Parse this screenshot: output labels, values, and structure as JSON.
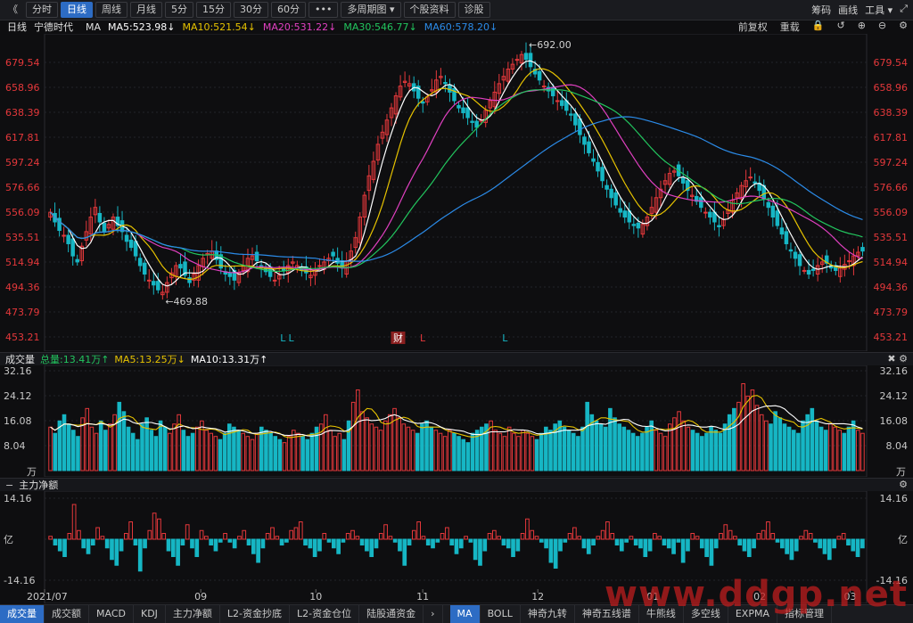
{
  "toolbar": {
    "back_icon": "double-chevron-left-icon",
    "periods": [
      "分时",
      "日线",
      "周线",
      "月线",
      "5分",
      "15分",
      "30分",
      "60分"
    ],
    "active_period": "日线",
    "more": "•••",
    "multi_period": "多周期图 ▾",
    "stock_info": "个股资料",
    "diagnose": "诊股",
    "right": [
      "筹码",
      "画线",
      "工具 ▾"
    ],
    "expand_icon": "expand-icon"
  },
  "legend": {
    "period": "日线",
    "stock_name": "宁德时代",
    "ma_label": "MA",
    "ma5": "MA5:523.98↓",
    "ma10": "MA10:521.54↓",
    "ma20": "MA20:531.22↓",
    "ma30": "MA30:546.77↓",
    "ma60": "MA60:578.20↓",
    "adjust": "前复权",
    "overlay": "重载"
  },
  "volume_head": {
    "title": "成交量",
    "total": "总量:13.41万↑",
    "ma5": "MA5:13.25万↓",
    "ma10": "MA10:13.31万↑"
  },
  "money_head": {
    "title": "主力净额"
  },
  "colors": {
    "up": "#e5383b",
    "down": "#16b6c4",
    "ma5": "#ffffff",
    "ma10": "#e6c200",
    "ma20": "#e040c0",
    "ma30": "#22c55e",
    "ma60": "#2b8be8"
  },
  "chart_data": [
    {
      "type": "candlestick",
      "title": "宁德时代 日线",
      "y_ticks": [
        "679.54",
        "658.96",
        "638.39",
        "617.81",
        "597.24",
        "576.66",
        "556.09",
        "535.51",
        "514.94",
        "494.36",
        "473.79",
        "453.21"
      ],
      "ylim": [
        453.21,
        679.54
      ],
      "x_ticks": [
        "2021/07",
        "09",
        "10",
        "11",
        "12",
        "01",
        "02",
        "03"
      ],
      "annotations": [
        {
          "label": "←692.00",
          "type": "high"
        },
        {
          "label": "←469.88",
          "type": "low"
        }
      ],
      "markers": [
        "L",
        "L",
        "财",
        "L",
        "L"
      ],
      "closes": [
        556,
        548,
        541,
        537,
        530,
        520,
        515,
        528,
        540,
        552,
        560,
        548,
        540,
        546,
        552,
        545,
        540,
        532,
        527,
        520,
        512,
        505,
        500,
        496,
        492,
        490,
        498,
        506,
        512,
        510,
        504,
        498,
        505,
        512,
        518,
        522,
        524,
        517,
        510,
        505,
        503,
        500,
        506,
        512,
        518,
        520,
        516,
        510,
        507,
        503,
        500,
        504,
        508,
        512,
        515,
        512,
        508,
        506,
        504,
        508,
        512,
        515,
        518,
        520,
        514,
        510,
        516,
        524,
        535,
        552,
        570,
        586,
        598,
        612,
        622,
        632,
        642,
        652,
        660,
        664,
        662,
        656,
        650,
        646,
        651,
        657,
        665,
        668,
        662,
        655,
        648,
        642,
        638,
        634,
        630,
        626,
        632,
        640,
        648,
        655,
        662,
        668,
        674,
        678,
        682,
        686,
        682,
        676,
        670,
        665,
        660,
        656,
        652,
        648,
        644,
        640,
        636,
        628,
        620,
        612,
        605,
        598,
        590,
        582,
        575,
        568,
        562,
        556,
        552,
        548,
        545,
        543,
        546,
        552,
        560,
        568,
        575,
        582,
        588,
        590,
        586,
        580,
        574,
        570,
        565,
        560,
        556,
        552,
        548,
        544,
        550,
        558,
        566,
        572,
        578,
        582,
        585,
        580,
        574,
        567,
        560,
        552,
        545,
        538,
        530,
        524,
        518,
        512,
        508,
        505,
        508,
        512,
        515,
        514,
        510,
        508,
        510,
        513,
        516,
        520,
        523,
        524
      ]
    },
    {
      "type": "bar",
      "title": "成交量",
      "unit": "万",
      "y_ticks": [
        "32.16",
        "24.12",
        "16.08",
        "8.04"
      ],
      "ylim": [
        0,
        32.16
      ],
      "values": [
        14,
        12,
        16,
        18,
        15,
        13,
        11,
        17,
        20,
        14,
        12,
        16,
        13,
        15,
        18,
        22,
        19,
        14,
        12,
        10,
        15,
        17,
        13,
        11,
        16,
        14,
        12,
        15,
        18,
        13,
        11,
        12,
        14,
        16,
        13,
        12,
        11,
        10,
        12,
        15,
        14,
        13,
        12,
        11,
        10,
        12,
        14,
        13,
        12,
        11,
        10,
        9,
        11,
        13,
        12,
        11,
        10,
        12,
        14,
        15,
        18,
        13,
        11,
        12,
        10,
        16,
        22,
        26,
        19,
        17,
        15,
        14,
        13,
        16,
        18,
        20,
        17,
        15,
        14,
        13,
        12,
        15,
        16,
        14,
        13,
        12,
        11,
        13,
        12,
        11,
        10,
        9,
        12,
        13,
        14,
        15,
        16,
        13,
        12,
        11,
        14,
        12,
        11,
        13,
        12,
        11,
        10,
        12,
        14,
        13,
        15,
        16,
        14,
        13,
        12,
        11,
        14,
        22,
        18,
        16,
        15,
        14,
        20,
        17,
        15,
        14,
        13,
        12,
        11,
        12,
        14,
        16,
        13,
        12,
        11,
        15,
        17,
        19,
        16,
        14,
        13,
        12,
        11,
        12,
        14,
        13,
        12,
        15,
        18,
        20,
        22,
        28,
        24,
        26,
        21,
        18,
        16,
        15,
        19,
        17,
        15,
        14,
        13,
        12,
        16,
        18,
        20,
        16,
        14,
        13,
        15,
        14,
        13,
        12,
        14,
        16,
        13,
        12
      ]
    },
    {
      "type": "bar",
      "title": "主力净额",
      "unit": "亿",
      "y_ticks": [
        "14.16",
        "亿",
        "-14.16"
      ],
      "ylim": [
        -14.16,
        14.16
      ],
      "values": [
        1,
        -2,
        -4,
        -6,
        2,
        12,
        3,
        -3,
        -5,
        -2,
        4,
        1,
        -3,
        -7,
        -9,
        -4,
        2,
        6,
        -2,
        -11,
        -3,
        3,
        9,
        7,
        2,
        -4,
        -6,
        -9,
        -2,
        5,
        -3,
        -6,
        3,
        1,
        -2,
        -4,
        -1,
        2,
        -1,
        -3,
        1,
        3,
        -2,
        -5,
        -8,
        -3,
        2,
        4,
        1,
        -2,
        -1,
        3,
        4,
        6,
        -2,
        -3,
        -6,
        -4,
        2,
        -1,
        -3,
        -5,
        -1,
        2,
        3,
        1,
        -2,
        -4,
        -6,
        -3,
        2,
        5,
        1,
        -1,
        -4,
        -9,
        -2,
        3,
        6,
        1,
        -2,
        -3,
        -1,
        2,
        4,
        -2,
        -5,
        -3,
        1,
        -1,
        -7,
        -9,
        -4,
        2,
        3,
        1,
        -2,
        -3,
        -6,
        -4,
        2,
        7,
        3,
        1,
        -1,
        -3,
        -8,
        -10,
        -4,
        -1,
        2,
        4,
        1,
        -3,
        -5,
        -2,
        1,
        3,
        6,
        2,
        -2,
        -4,
        -1,
        1,
        -2,
        -3,
        -6,
        -4,
        2,
        1,
        -2,
        -3,
        -5,
        -1,
        -8,
        -4,
        2,
        1,
        -3,
        -6,
        -9,
        -3,
        2,
        5,
        3,
        1,
        -2,
        -4,
        -6,
        -3,
        2,
        3,
        6,
        2,
        -1,
        -3,
        -5,
        -7,
        -4,
        1,
        3,
        2,
        -1,
        -3,
        -5,
        -7,
        -3,
        1,
        2,
        -2,
        -4,
        -6,
        -3
      ]
    }
  ],
  "bottom_tabs": [
    "成交量",
    "成交额",
    "MACD",
    "KDJ",
    "主力净额",
    "L2-资金抄底",
    "L2-资金仓位",
    "陆股通资金"
  ],
  "bottom_tabs_active": "成交量",
  "bottom_tabs2": [
    "MA",
    "BOLL",
    "神奇九转",
    "神奇五线谱",
    "牛熊线",
    "多空线",
    "EXPMA",
    "指标管理"
  ],
  "bottom_tabs2_active": "MA",
  "watermark": "www.ddgp.net"
}
